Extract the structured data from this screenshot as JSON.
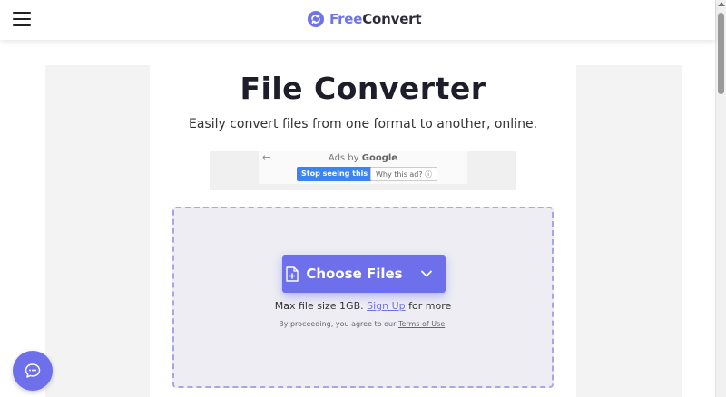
{
  "header": {
    "logo_free": "Free",
    "logo_convert": "Convert"
  },
  "main": {
    "title": "File Converter",
    "subtitle": "Easily convert files from one format to another, online."
  },
  "ad": {
    "back_glyph": "←",
    "label_prefix": "Ads by ",
    "label_brand": "Google",
    "stop_label": "Stop seeing this ad",
    "why_label": "Why this ad? ⓘ"
  },
  "upload": {
    "choose_label": "Choose Files",
    "max_prefix": "Max file size 1GB. ",
    "signup_link": "Sign Up",
    "max_suffix": " for more",
    "terms_prefix": "By proceeding, you agree to our ",
    "terms_link": "Terms of Use",
    "terms_suffix": "."
  },
  "colors": {
    "accent": "#6d70ea",
    "dropzone_bg": "#ededf3",
    "dropzone_border": "#a9a6e6",
    "ad_button": "#3b83f0"
  },
  "icons": {
    "menu": "hamburger-menu-icon",
    "logo": "freeconvert-logo-icon",
    "file": "file-add-icon",
    "dropdown": "chevron-down-icon",
    "chat": "chat-bubble-icon"
  }
}
